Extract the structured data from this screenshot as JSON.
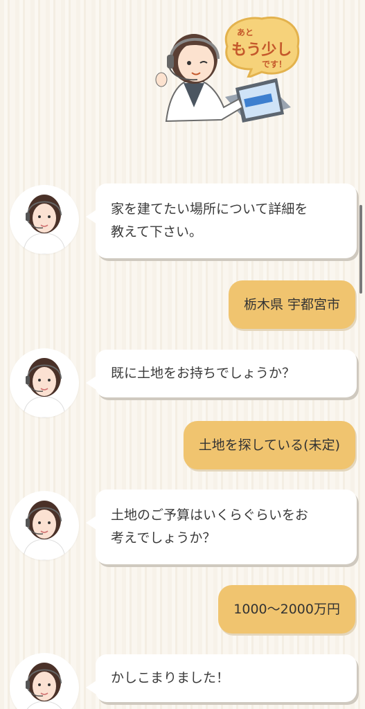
{
  "header": {
    "badge_small_top": "あと",
    "badge_big": "もう少し",
    "badge_small_bottom": "です！"
  },
  "messages": [
    {
      "from": "bot",
      "text_line1": "家を建てたい場所について詳細を",
      "text_line2": "教えて下さい。"
    },
    {
      "from": "user",
      "text": "栃木県 宇都宮市"
    },
    {
      "from": "bot",
      "text_line1": "既に土地をお持ちでしょうか？"
    },
    {
      "from": "user",
      "text": "土地を探している(未定)"
    },
    {
      "from": "bot",
      "text_line1": "土地のご予算はいくらぐらいをお",
      "text_line2": "考えでしょうか？"
    },
    {
      "from": "user",
      "text": "1000〜2000万円"
    },
    {
      "from": "bot",
      "text_line1": "かしこまりました！"
    }
  ],
  "colors": {
    "user_bubble": "#f0c46f",
    "bot_bubble": "#ffffff",
    "badge_orange": "#c4582b"
  },
  "icons": {
    "operator_illustration": "operator-with-laptop-icon",
    "avatar": "operator-avatar-icon"
  }
}
